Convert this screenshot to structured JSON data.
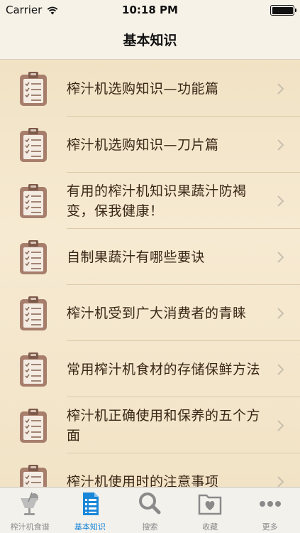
{
  "status_bar": {
    "carrier": "Carrier",
    "time": "10:18 PM",
    "battery_level": 1.0
  },
  "nav": {
    "title": "基本知识"
  },
  "list": {
    "items": [
      {
        "label": "榨汁机选购知识—功能篇",
        "icon": "clipboard-icon"
      },
      {
        "label": "榨汁机选购知识—刀片篇",
        "icon": "clipboard-icon"
      },
      {
        "label": "有用的榨汁机知识果蔬汁防褐变，保我健康！",
        "icon": "clipboard-icon"
      },
      {
        "label": "自制果蔬汁有哪些要诀",
        "icon": "clipboard-icon"
      },
      {
        "label": "榨汁机受到广大消费者的青睐",
        "icon": "clipboard-icon"
      },
      {
        "label": "常用榨汁机食材的存储保鲜方法",
        "icon": "clipboard-icon"
      },
      {
        "label": "榨汁机正确使用和保养的五个方面",
        "icon": "clipboard-icon"
      },
      {
        "label": "榨汁机使用时的注意事项",
        "icon": "clipboard-icon"
      }
    ]
  },
  "tab_bar": {
    "active_color": "#1a86d8",
    "tabs": [
      {
        "label": "榨汁机食谱",
        "icon": "juicer-icon",
        "active": false
      },
      {
        "label": "基本知识",
        "icon": "document-icon",
        "active": true
      },
      {
        "label": "搜索",
        "icon": "search-icon",
        "active": false
      },
      {
        "label": "收藏",
        "icon": "favorites-folder-icon",
        "active": false
      },
      {
        "label": "更多",
        "icon": "more-icon",
        "active": false
      }
    ]
  }
}
